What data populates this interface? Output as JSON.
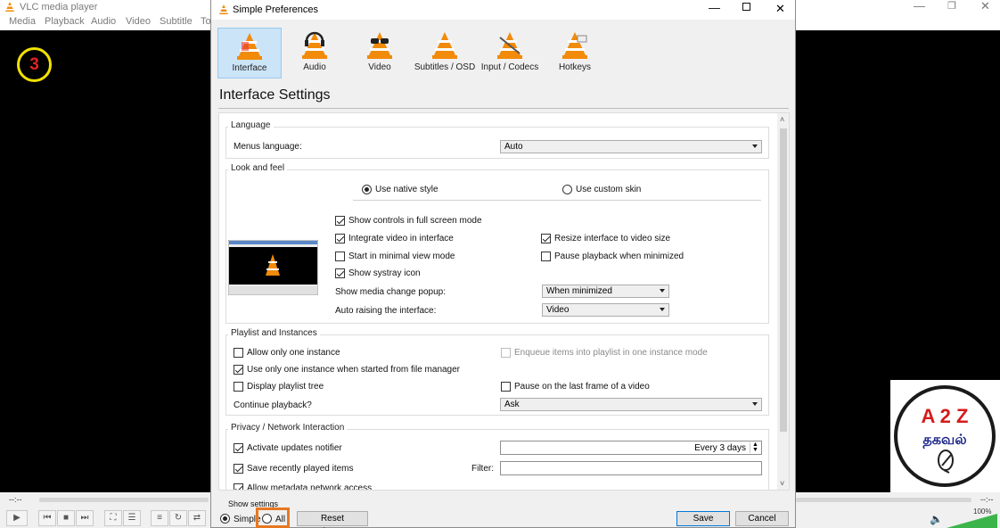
{
  "vlc": {
    "title": "VLC media player",
    "menu": [
      "Media",
      "Playback",
      "Audio",
      "Video",
      "Subtitle",
      "To"
    ],
    "step_badge": "3",
    "time_left": "--:--",
    "time_right": "--:--",
    "volume": "100%",
    "volume_level": 1.0
  },
  "logo": {
    "line1": "A 2 Z",
    "line2": "தகவல்"
  },
  "dialog": {
    "title": "Simple Preferences",
    "categories": [
      {
        "label": "Interface",
        "icon": "interface-cone-icon"
      },
      {
        "label": "Audio",
        "icon": "audio-cone-icon"
      },
      {
        "label": "Video",
        "icon": "video-cone-icon"
      },
      {
        "label": "Subtitles / OSD",
        "icon": "subtitles-cone-icon"
      },
      {
        "label": "Input / Codecs",
        "icon": "codecs-cone-icon"
      },
      {
        "label": "Hotkeys",
        "icon": "hotkeys-cone-icon"
      }
    ],
    "heading": "Interface Settings",
    "language": {
      "group": "Language",
      "menus_label": "Menus language:",
      "menus_value": "Auto"
    },
    "look": {
      "group": "Look and feel",
      "native": "Use native style",
      "custom": "Use custom skin",
      "show_controls": "Show controls in full screen mode",
      "integrate": "Integrate video in interface",
      "resize": "Resize interface to video size",
      "minimal": "Start in minimal view mode",
      "pause_min": "Pause playback when minimized",
      "systray": "Show systray icon",
      "popup_label": "Show media change popup:",
      "popup_value": "When minimized",
      "raise_label": "Auto raising the interface:",
      "raise_value": "Video"
    },
    "playlist": {
      "group": "Playlist and Instances",
      "one_instance": "Allow only one instance",
      "enqueue": "Enqueue items into playlist in one instance mode",
      "file_manager": "Use only one instance when started from file manager",
      "tree": "Display playlist tree",
      "pause_last": "Pause on the last frame of a video",
      "continue_label": "Continue playback?",
      "continue_value": "Ask"
    },
    "privacy": {
      "group": "Privacy / Network Interaction",
      "updates": "Activate updates notifier",
      "updates_value": "Every 3 days",
      "recent": "Save recently played items",
      "filter_label": "Filter:",
      "filter_value": "",
      "metadata": "Allow metadata network access"
    },
    "show_settings": "Show settings",
    "simple": "Simple",
    "all": "All",
    "reset": "Reset Preferences",
    "save": "Save",
    "cancel": "Cancel"
  }
}
